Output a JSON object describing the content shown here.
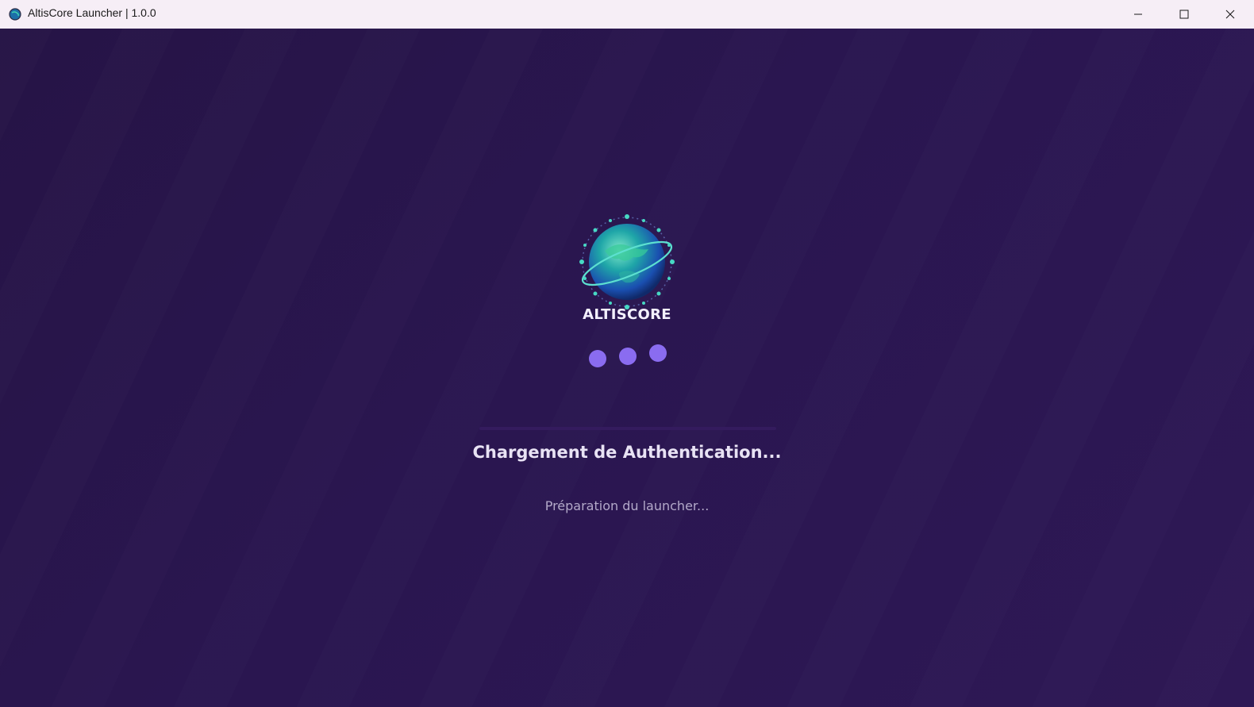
{
  "window": {
    "title": "AltisCore Launcher | 1.0.0",
    "icons": {
      "app": "globe-icon",
      "minimize": "minimize-icon",
      "maximize": "maximize-icon",
      "close": "close-icon"
    }
  },
  "splash": {
    "logo_text": "ALTISCORE",
    "logo_icon": "globe-logo-icon",
    "loading_title": "Chargement de Authentication...",
    "loading_subtitle": "Préparation du launcher...",
    "progress": 0
  },
  "colors": {
    "background": "#2a1650",
    "titlebar": "#f6eef6",
    "accent": "#8a6cf0",
    "title_text": "#e8e2f4",
    "subtitle_text": "#b3a9c9"
  }
}
